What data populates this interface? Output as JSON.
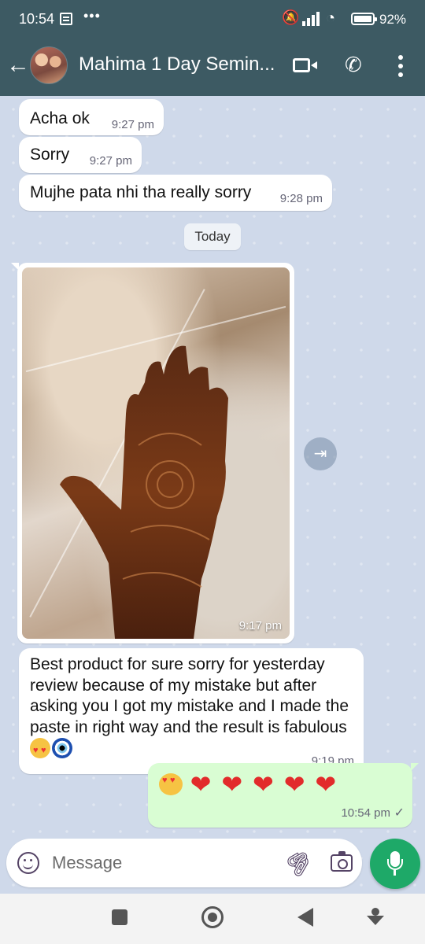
{
  "status_bar": {
    "time": "10:54",
    "battery": "92%"
  },
  "header": {
    "back_icon": "arrow-left-icon",
    "contact_name": "Mahima 1 Day Semin...",
    "video_icon": "video-call-icon",
    "call_icon": "phone-icon",
    "menu_icon": "more-vertical-icon"
  },
  "messages": [
    {
      "text": "Acha ok",
      "time": "9:27 pm"
    },
    {
      "text": "Sorry",
      "time": "9:27 pm"
    },
    {
      "text": "Mujhe pata nhi tha really sorry",
      "time": "9:28 pm"
    }
  ],
  "date_separator": "Today",
  "image_message": {
    "time": "9:17 pm",
    "forward_icon": "forward-icon"
  },
  "review_message": {
    "text": "Best product for sure sorry for yesterday review because of my mistake but after asking you I got my mistake and I made the paste in right way and the result is fabulous",
    "time": "9:19 pm",
    "emojis": [
      "smiling-face-with-heart-eyes",
      "nazar-amulet"
    ]
  },
  "outgoing_message": {
    "emojis": [
      "smiling-face-with-heart-eyes",
      "red-heart",
      "red-heart",
      "red-heart",
      "red-heart",
      "red-heart"
    ],
    "time": "10:54 pm",
    "status_icon": "single-check-icon"
  },
  "composer": {
    "placeholder": "Message",
    "emoji_icon": "emoji-icon",
    "attach_icon": "paperclip-icon",
    "camera_icon": "camera-icon",
    "mic_icon": "microphone-icon"
  },
  "colors": {
    "header": "#3d5a63",
    "chat_background": "#cfd9ea",
    "incoming_bubble": "#ffffff",
    "outgoing_bubble": "#d9fdd3",
    "mic_button": "#1ea968"
  }
}
